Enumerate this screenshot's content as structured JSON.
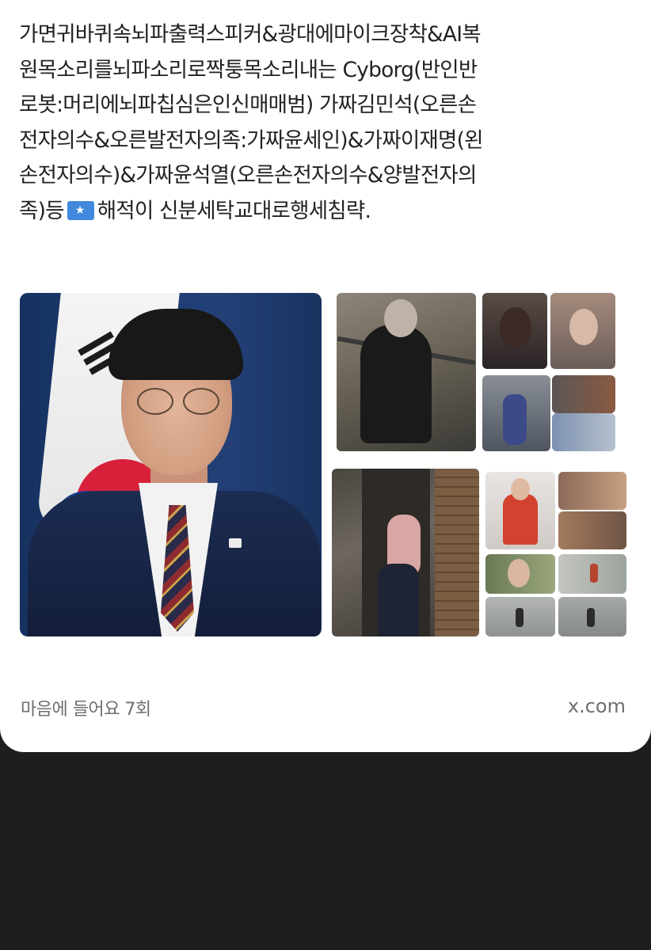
{
  "post": {
    "lines": [
      "가면귀바퀴속뇌파출력스피커&광대에마이크장착&AI복",
      "원목소리를뇌파소리로짝퉁목소리내는 Cyborg(반인반",
      "로봇:머리에뇌파칩심은인신매매범) 가짜김민석(오른손",
      "전자의수&오른발전자의족:가짜윤세인)&가짜이재명(왼",
      "손전자의수)&가짜윤석열(오른손전자의수&양발전자의"
    ],
    "last_line_before": "족)등",
    "flag_icon": "somalia-flag-emoji",
    "last_line_after": "해적이 신분세탁교대로행세침략."
  },
  "footer": {
    "likes": "마음에 들어요 7회",
    "source": "x.com"
  },
  "colors": {
    "card_background": "#ffffff",
    "page_background": "#1e1e1e",
    "text": "#222222",
    "meta_text": "#6f6f6f"
  }
}
